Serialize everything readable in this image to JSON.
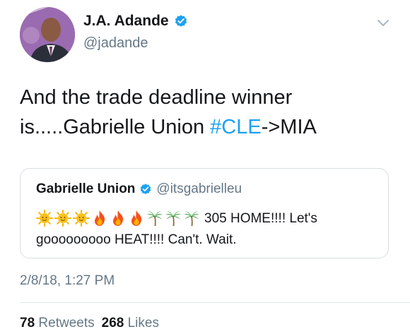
{
  "author": {
    "name": "J.A. Adande",
    "handle": "@jadande",
    "verified": true,
    "avatar_icon": "profile-photo"
  },
  "tweet": {
    "text_before": "And the trade deadline winner is.....Gabrielle Union ",
    "hashtag": "#CLE",
    "text_after": "->MIA"
  },
  "quoted_tweet": {
    "name": "Gabrielle Union",
    "handle": "@itsgabrielleu",
    "verified": true,
    "emojis": [
      "sun-emoji",
      "sun-emoji",
      "sun-emoji",
      "fire-emoji",
      "fire-emoji",
      "fire-emoji",
      "palm-tree-emoji",
      "palm-tree-emoji",
      "palm-tree-emoji"
    ],
    "text": "305 HOME!!!! Let's gooooooooo HEAT!!!! Can't. Wait."
  },
  "timestamp": "2/8/18, 1:27 PM",
  "stats": {
    "retweets_count": "78",
    "retweets_label": "Retweets",
    "likes_count": "268",
    "likes_label": "Likes"
  },
  "colors": {
    "accent": "#1da1f2",
    "secondary_text": "#657786",
    "primary_text": "#14171a"
  }
}
